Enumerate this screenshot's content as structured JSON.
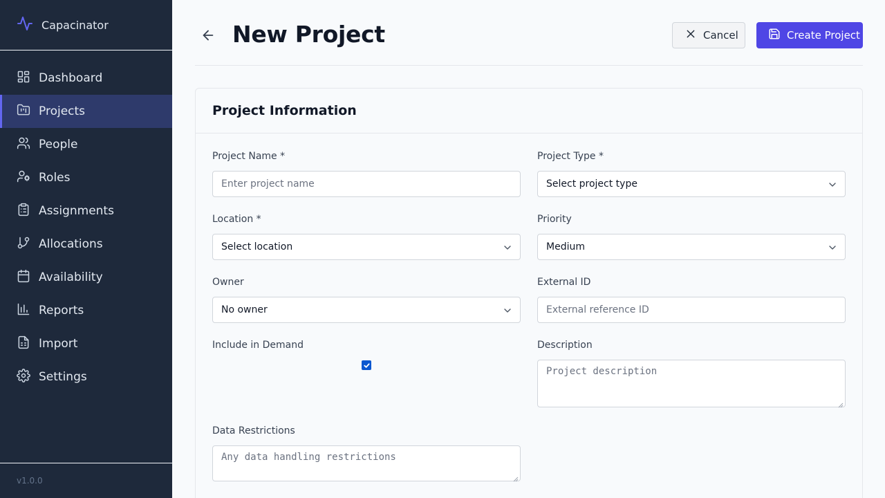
{
  "app": {
    "name": "Capacinator",
    "version": "v1.0.0"
  },
  "sidebar": {
    "items": [
      {
        "label": "Dashboard",
        "icon": "dashboard-icon",
        "active": false
      },
      {
        "label": "Projects",
        "icon": "folder-kanban-icon",
        "active": true
      },
      {
        "label": "People",
        "icon": "users-icon",
        "active": false
      },
      {
        "label": "Roles",
        "icon": "user-cog-icon",
        "active": false
      },
      {
        "label": "Assignments",
        "icon": "clipboard-list-icon",
        "active": false
      },
      {
        "label": "Allocations",
        "icon": "git-branch-icon",
        "active": false
      },
      {
        "label": "Availability",
        "icon": "calendar-icon",
        "active": false
      },
      {
        "label": "Reports",
        "icon": "bar-chart-icon",
        "active": false
      },
      {
        "label": "Import",
        "icon": "file-spreadsheet-icon",
        "active": false
      },
      {
        "label": "Settings",
        "icon": "gear-icon",
        "active": false
      }
    ]
  },
  "header": {
    "title": "New Project",
    "cancel_label": "Cancel",
    "create_label": "Create Project"
  },
  "form": {
    "section_title": "Project Information",
    "project_name": {
      "label": "Project Name *",
      "placeholder": "Enter project name"
    },
    "project_type": {
      "label": "Project Type *",
      "value": "Select project type"
    },
    "location": {
      "label": "Location *",
      "value": "Select location"
    },
    "priority": {
      "label": "Priority",
      "value": "Medium"
    },
    "owner": {
      "label": "Owner",
      "value": "No owner"
    },
    "external_id": {
      "label": "External ID",
      "placeholder": "External reference ID"
    },
    "include_in_demand": {
      "label": "Include in Demand",
      "checked": true
    },
    "description": {
      "label": "Description",
      "placeholder": "Project description"
    },
    "data_restrictions": {
      "label": "Data Restrictions",
      "placeholder": "Any data handling restrictions"
    }
  },
  "colors": {
    "sidebar_bg": "#1e293b",
    "accent": "#4f46e5",
    "active_nav_bg": "#2e3a6b"
  }
}
